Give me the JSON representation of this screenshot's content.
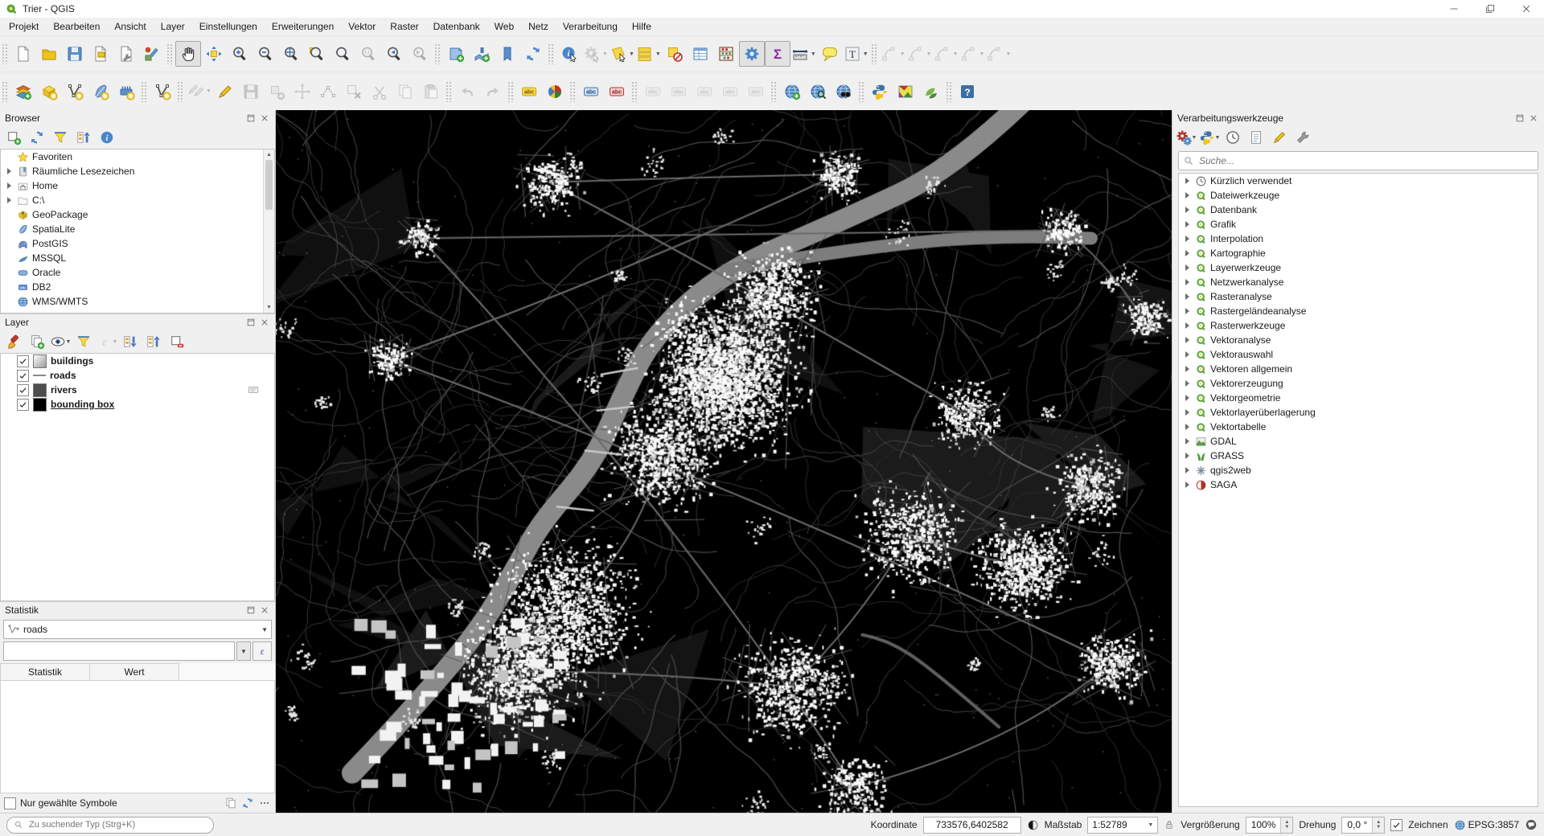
{
  "window": {
    "title": "Trier - QGIS"
  },
  "menubar": [
    "Projekt",
    "Bearbeiten",
    "Ansicht",
    "Layer",
    "Einstellungen",
    "Erweiterungen",
    "Vektor",
    "Raster",
    "Datenbank",
    "Web",
    "Netz",
    "Verarbeitung",
    "Hilfe"
  ],
  "toolbar_row1": [
    {
      "items": [
        {
          "name": "new-project",
          "kind": "page"
        },
        {
          "name": "open-project",
          "kind": "folder"
        },
        {
          "name": "save-project",
          "kind": "floppy"
        },
        {
          "name": "new-print-layout",
          "kind": "pageLayout"
        },
        {
          "name": "layout-manager",
          "kind": "pageWrench"
        },
        {
          "name": "style-manager",
          "kind": "styleMgr"
        }
      ]
    },
    {
      "items": [
        {
          "name": "pan-map",
          "kind": "hand",
          "active": true
        },
        {
          "name": "pan-to-selection",
          "kind": "arrows4"
        },
        {
          "name": "zoom-in",
          "kind": "magPlus"
        },
        {
          "name": "zoom-out",
          "kind": "magMinus"
        },
        {
          "name": "zoom-full-extent",
          "kind": "magFull"
        },
        {
          "name": "zoom-to-selection",
          "kind": "magSel"
        },
        {
          "name": "zoom-to-layer",
          "kind": "magLayer"
        },
        {
          "name": "zoom-native",
          "kind": "mag11",
          "disabled": true
        },
        {
          "name": "zoom-last",
          "kind": "magLast"
        },
        {
          "name": "zoom-next",
          "kind": "magNext",
          "disabled": true
        }
      ]
    },
    {
      "items": [
        {
          "name": "new-map-view",
          "kind": "mapView"
        },
        {
          "name": "new-3d-map-view",
          "kind": "map3d"
        },
        {
          "name": "spatial-bookmarks",
          "kind": "bookmark"
        },
        {
          "name": "refresh-map",
          "kind": "refresh"
        }
      ]
    },
    {
      "items": [
        {
          "name": "identify-features",
          "kind": "info"
        },
        {
          "name": "run-feature-action",
          "kind": "actionRun",
          "disabled": true,
          "dd": true
        },
        {
          "name": "select-features",
          "kind": "selectCursor",
          "dd": true
        },
        {
          "name": "select-by-value",
          "kind": "selectBars",
          "dd": true
        },
        {
          "name": "deselect-all",
          "kind": "deselect"
        },
        {
          "name": "open-attribute-table",
          "kind": "table"
        },
        {
          "name": "statistical-summary",
          "kind": "abacus"
        },
        {
          "name": "processing-toolbox",
          "kind": "gearBlue",
          "active": true
        },
        {
          "name": "statistics-panel",
          "kind": "sigma",
          "active": true
        },
        {
          "name": "measure-line",
          "kind": "ruler",
          "dd": true
        },
        {
          "name": "map-tips",
          "kind": "bubble"
        },
        {
          "name": "text-annotation",
          "kind": "textT",
          "dd": true
        }
      ]
    },
    {
      "items": [
        {
          "name": "digitize-curve",
          "kind": "digit",
          "disabled": true,
          "dd": true
        },
        {
          "name": "digitize-circle",
          "kind": "digit",
          "disabled": true,
          "dd": true
        },
        {
          "name": "digitize-ellipse",
          "kind": "digit",
          "disabled": true,
          "dd": true
        },
        {
          "name": "digitize-rectangle",
          "kind": "digit",
          "disabled": true,
          "dd": true
        },
        {
          "name": "digitize-polygon",
          "kind": "digit",
          "disabled": true,
          "dd": true
        }
      ]
    }
  ],
  "toolbar_row2": [
    {
      "items": [
        {
          "name": "data-source-manager",
          "kind": "layersAdd"
        },
        {
          "name": "new-geopackage-layer",
          "kind": "gpkgStar"
        },
        {
          "name": "new-shapefile-layer",
          "kind": "vStar"
        },
        {
          "name": "new-spatialite-layer",
          "kind": "featherStar"
        },
        {
          "name": "new-mesh-layer",
          "kind": "meshStar"
        }
      ]
    },
    {
      "items": [
        {
          "name": "new-virtual-layer",
          "kind": "vStar"
        }
      ]
    },
    {
      "items": [
        {
          "name": "current-edits",
          "kind": "pencilPair",
          "disabled": true,
          "dd": true
        },
        {
          "name": "toggle-editing",
          "kind": "pencil"
        },
        {
          "name": "save-layer-edits",
          "kind": "savePage",
          "disabled": true
        },
        {
          "name": "add-feature",
          "kind": "addFeat",
          "disabled": true
        },
        {
          "name": "move-feature",
          "kind": "moveFeat",
          "disabled": true
        },
        {
          "name": "vertex-tool",
          "kind": "nodeTool",
          "disabled": true
        },
        {
          "name": "delete-selected",
          "kind": "delSel",
          "disabled": true
        },
        {
          "name": "cut-features",
          "kind": "scissors",
          "disabled": true
        },
        {
          "name": "copy-features",
          "kind": "copy2",
          "disabled": true
        },
        {
          "name": "paste-features",
          "kind": "paste",
          "disabled": true
        }
      ]
    },
    {
      "items": [
        {
          "name": "undo",
          "kind": "undo",
          "disabled": true
        },
        {
          "name": "redo",
          "kind": "redo",
          "disabled": true
        }
      ]
    },
    {
      "items": [
        {
          "name": "layer-labeling",
          "kind": "abcYellow"
        },
        {
          "name": "layer-diagram",
          "kind": "pie"
        }
      ]
    },
    {
      "items": [
        {
          "name": "labeling-options",
          "kind": "abcBlue"
        },
        {
          "name": "pin-labels",
          "kind": "abcRed"
        }
      ]
    },
    {
      "items": [
        {
          "name": "highlight-pinned-labels",
          "kind": "abcGrey",
          "disabled": true
        },
        {
          "name": "show-hide-labels",
          "kind": "abcGrey",
          "disabled": true
        },
        {
          "name": "move-label",
          "kind": "abcGrey",
          "disabled": true
        },
        {
          "name": "rotate-label",
          "kind": "abcGrey",
          "disabled": true
        },
        {
          "name": "change-label",
          "kind": "abcGrey",
          "disabled": true
        }
      ]
    },
    {
      "items": [
        {
          "name": "metasearch-new",
          "kind": "globePlus"
        },
        {
          "name": "metasearch",
          "kind": "globeMag"
        },
        {
          "name": "search-layers",
          "kind": "globeBinoc"
        }
      ]
    },
    {
      "items": [
        {
          "name": "python-console",
          "kind": "python"
        },
        {
          "name": "qgis2web",
          "kind": "webmap"
        },
        {
          "name": "saga-toolbox",
          "kind": "leaves"
        }
      ]
    },
    {
      "items": [
        {
          "name": "help",
          "kind": "helpBlue"
        }
      ]
    }
  ],
  "panels": {
    "browser": {
      "title": "Browser",
      "toolbar": [
        {
          "name": "add-selected-layer",
          "kind": "addLayer"
        },
        {
          "name": "refresh-browser",
          "kind": "refresh"
        },
        {
          "name": "filter-browser",
          "kind": "funnel"
        },
        {
          "name": "collapse-all-browser",
          "kind": "collapseT"
        },
        {
          "name": "browser-properties",
          "kind": "info2"
        }
      ],
      "items": [
        {
          "id": "favoriten",
          "label": "Favoriten",
          "kind": "star",
          "expander": false
        },
        {
          "id": "raeumliche-lesezeichen",
          "label": "Räumliche Lesezeichen",
          "kind": "book",
          "expander": true
        },
        {
          "id": "home",
          "label": "Home",
          "kind": "home",
          "expander": true
        },
        {
          "id": "c-drive",
          "label": "C:\\",
          "kind": "folderC",
          "expander": true
        },
        {
          "id": "geopackage",
          "label": "GeoPackage",
          "kind": "gpkg",
          "expander": false
        },
        {
          "id": "spatialite",
          "label": "SpatiaLite",
          "kind": "feather",
          "expander": false
        },
        {
          "id": "postgis",
          "label": "PostGIS",
          "kind": "elephant",
          "expander": false
        },
        {
          "id": "mssql",
          "label": "MSSQL",
          "kind": "wave",
          "expander": false
        },
        {
          "id": "oracle",
          "label": "Oracle",
          "kind": "oracle",
          "expander": false
        },
        {
          "id": "db2",
          "label": "DB2",
          "kind": "db2",
          "expander": false
        },
        {
          "id": "wms-wmts",
          "label": "WMS/WMTS",
          "kind": "globe",
          "expander": false
        }
      ]
    },
    "layer": {
      "title": "Layer",
      "toolbar": [
        {
          "name": "open-layer-styling",
          "kind": "brush"
        },
        {
          "name": "add-group",
          "kind": "groupPlus"
        },
        {
          "name": "manage-map-themes",
          "kind": "eye",
          "dd": true
        },
        {
          "name": "filter-legend",
          "kind": "funnel"
        },
        {
          "name": "filter-by-expression",
          "kind": "epsilonGrey",
          "disabled": true,
          "dd": true
        },
        {
          "name": "expand-all-layers",
          "kind": "expandT"
        },
        {
          "name": "collapse-all-layers",
          "kind": "collapseT"
        },
        {
          "name": "remove-layer",
          "kind": "removeL"
        }
      ],
      "items": [
        {
          "id": "buildings",
          "label": "buildings",
          "checked": true,
          "swatch": "buildings"
        },
        {
          "id": "roads",
          "label": "roads",
          "checked": true,
          "swatch": "roads"
        },
        {
          "id": "rivers",
          "label": "rivers",
          "checked": true,
          "swatch": "rivers",
          "note": true
        },
        {
          "id": "bounding-box",
          "label": "bounding box",
          "checked": true,
          "swatch": "bounding",
          "selected": true
        }
      ]
    },
    "statistics": {
      "title": "Statistik",
      "layer_combo_value": "roads",
      "columns": [
        "Statistik",
        "Wert"
      ],
      "footer_label": "Nur gewählte Symbole",
      "footer_checked": false,
      "footer_buttons": [
        {
          "name": "copy-statistics",
          "kind": "copy2"
        },
        {
          "name": "refresh-statistics",
          "kind": "refresh"
        },
        {
          "name": "statistics-options",
          "kind": "dots"
        }
      ]
    },
    "processing": {
      "title": "Verarbeitungswerkzeuge",
      "search_placeholder": "Suche...",
      "toolbar": [
        {
          "name": "processing-models",
          "kind": "gearsRed",
          "dd": true
        },
        {
          "name": "processing-scripts",
          "kind": "python",
          "dd": true
        },
        {
          "name": "processing-history",
          "kind": "clock"
        },
        {
          "name": "results-viewer",
          "kind": "paperList"
        },
        {
          "name": "edit-features-in-place",
          "kind": "pencil"
        },
        {
          "name": "processing-options",
          "kind": "wrench"
        }
      ],
      "items": [
        {
          "id": "kuerzlich-verwendet",
          "label": "Kürzlich verwendet",
          "kind": "clock"
        },
        {
          "id": "dateiwerkzeuge",
          "label": "Dateiwerkzeuge",
          "kind": "q"
        },
        {
          "id": "datenbank",
          "label": "Datenbank",
          "kind": "q"
        },
        {
          "id": "grafik",
          "label": "Grafik",
          "kind": "q"
        },
        {
          "id": "interpolation",
          "label": "Interpolation",
          "kind": "q"
        },
        {
          "id": "kartographie",
          "label": "Kartographie",
          "kind": "q"
        },
        {
          "id": "layerwerkzeuge",
          "label": "Layerwerkzeuge",
          "kind": "q"
        },
        {
          "id": "netzwerkanalyse",
          "label": "Netzwerkanalyse",
          "kind": "q"
        },
        {
          "id": "rasteranalyse",
          "label": "Rasteranalyse",
          "kind": "q"
        },
        {
          "id": "rastergelaendeanalyse",
          "label": "Rastergeländeanalyse",
          "kind": "q"
        },
        {
          "id": "rasterwerkzeuge",
          "label": "Rasterwerkzeuge",
          "kind": "q"
        },
        {
          "id": "vektoranalyse",
          "label": "Vektoranalyse",
          "kind": "q"
        },
        {
          "id": "vektorauswahl",
          "label": "Vektorauswahl",
          "kind": "q"
        },
        {
          "id": "vektoren-allgemein",
          "label": "Vektoren allgemein",
          "kind": "q"
        },
        {
          "id": "vektorerzeugung",
          "label": "Vektorerzeugung",
          "kind": "q"
        },
        {
          "id": "vektorgeometrie",
          "label": "Vektorgeometrie",
          "kind": "q"
        },
        {
          "id": "vektorlayerueberlagerung",
          "label": "Vektorlayerüberlagerung",
          "kind": "q"
        },
        {
          "id": "vektortabelle",
          "label": "Vektortabelle",
          "kind": "q"
        },
        {
          "id": "gdal",
          "label": "GDAL",
          "kind": "gdal"
        },
        {
          "id": "grass",
          "label": "GRASS",
          "kind": "grass"
        },
        {
          "id": "qgis2web",
          "label": "qgis2web",
          "kind": "q2w"
        },
        {
          "id": "saga",
          "label": "SAGA",
          "kind": "saga"
        }
      ]
    }
  },
  "statusbar": {
    "locator_placeholder": "Zu suchender Typ (Strg+K)",
    "coordinate_label": "Koordinate",
    "coordinate_value": "733576,6402582",
    "scale_label": "Maßstab",
    "scale_value": "1:52789",
    "magnifier_label": "Vergrößerung",
    "magnifier_value": "100%",
    "rotation_label": "Drehung",
    "rotation_value": "0,0 °",
    "render_label": "Zeichnen",
    "render_checked": true,
    "crs_label": "EPSG:3857"
  }
}
